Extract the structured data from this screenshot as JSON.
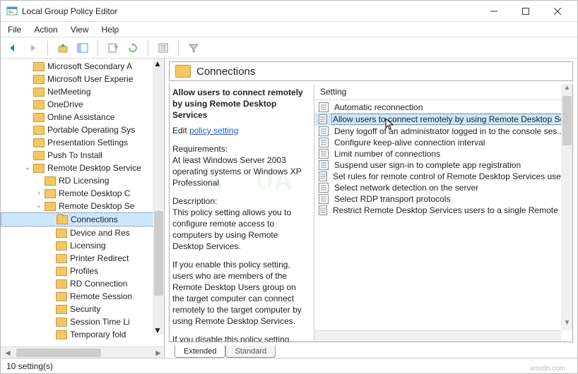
{
  "window": {
    "title": "Local Group Policy Editor"
  },
  "menu": {
    "file": "File",
    "action": "Action",
    "view": "View",
    "help": "Help"
  },
  "tree": {
    "items": [
      {
        "indent": 2,
        "label": "Microsoft Secondary A"
      },
      {
        "indent": 2,
        "label": "Microsoft User Experie"
      },
      {
        "indent": 2,
        "label": "NetMeeting"
      },
      {
        "indent": 2,
        "label": "OneDrive"
      },
      {
        "indent": 2,
        "label": "Online Assistance"
      },
      {
        "indent": 2,
        "label": "Portable Operating Sys"
      },
      {
        "indent": 2,
        "label": "Presentation Settings"
      },
      {
        "indent": 2,
        "label": "Push To Install"
      },
      {
        "indent": 2,
        "label": "Remote Desktop Service",
        "exp": "v"
      },
      {
        "indent": 3,
        "label": "RD Licensing"
      },
      {
        "indent": 3,
        "label": "Remote Desktop C",
        "exp": ">"
      },
      {
        "indent": 3,
        "label": "Remote Desktop Se",
        "exp": "v"
      },
      {
        "indent": 4,
        "label": "Connections",
        "selected": true
      },
      {
        "indent": 4,
        "label": "Device and Res"
      },
      {
        "indent": 4,
        "label": "Licensing"
      },
      {
        "indent": 4,
        "label": "Printer Redirect"
      },
      {
        "indent": 4,
        "label": "Profiles"
      },
      {
        "indent": 4,
        "label": "RD Connection"
      },
      {
        "indent": 4,
        "label": "Remote Session"
      },
      {
        "indent": 4,
        "label": "Security"
      },
      {
        "indent": 4,
        "label": "Session Time Li"
      },
      {
        "indent": 4,
        "label": "Temporary fold"
      }
    ]
  },
  "header": {
    "title": "Connections"
  },
  "desc": {
    "policy_title": "Allow users to connect remotely by using Remote Desktop Services",
    "edit_prefix": "Edit ",
    "edit_link": "policy setting",
    "req_label": "Requirements:",
    "req_body": "At least Windows Server 2003 operating systems or Windows XP Professional",
    "desc_label": "Description:",
    "desc_body1": "This policy setting allows you to configure remote access to computers by using Remote Desktop Services.",
    "desc_body2": "If you enable this policy setting, users who are members of the Remote Desktop Users group on the target computer can connect remotely to the target computer by using Remote Desktop Services.",
    "desc_body3": "If you disable this policy setting,"
  },
  "list": {
    "header": "Setting",
    "rows": [
      {
        "label": "Automatic reconnection"
      },
      {
        "label": "Allow users to connect remotely by using Remote Desktop Servic",
        "selected": true
      },
      {
        "label": "Deny logoff of an administrator logged in to the console ses..."
      },
      {
        "label": "Configure keep-alive connection interval"
      },
      {
        "label": "Limit number of connections"
      },
      {
        "label": "Suspend user sign-in to complete app registration"
      },
      {
        "label": "Set rules for remote control of Remote Desktop Services use..."
      },
      {
        "label": "Select network detection on the server"
      },
      {
        "label": "Select RDP transport protocols"
      },
      {
        "label": "Restrict Remote Desktop Services users to a single Remote D..."
      }
    ]
  },
  "tabs": {
    "extended": "Extended",
    "standard": "Standard"
  },
  "status": {
    "text": "10 setting(s)"
  },
  "watermark": "wsxdn.com"
}
